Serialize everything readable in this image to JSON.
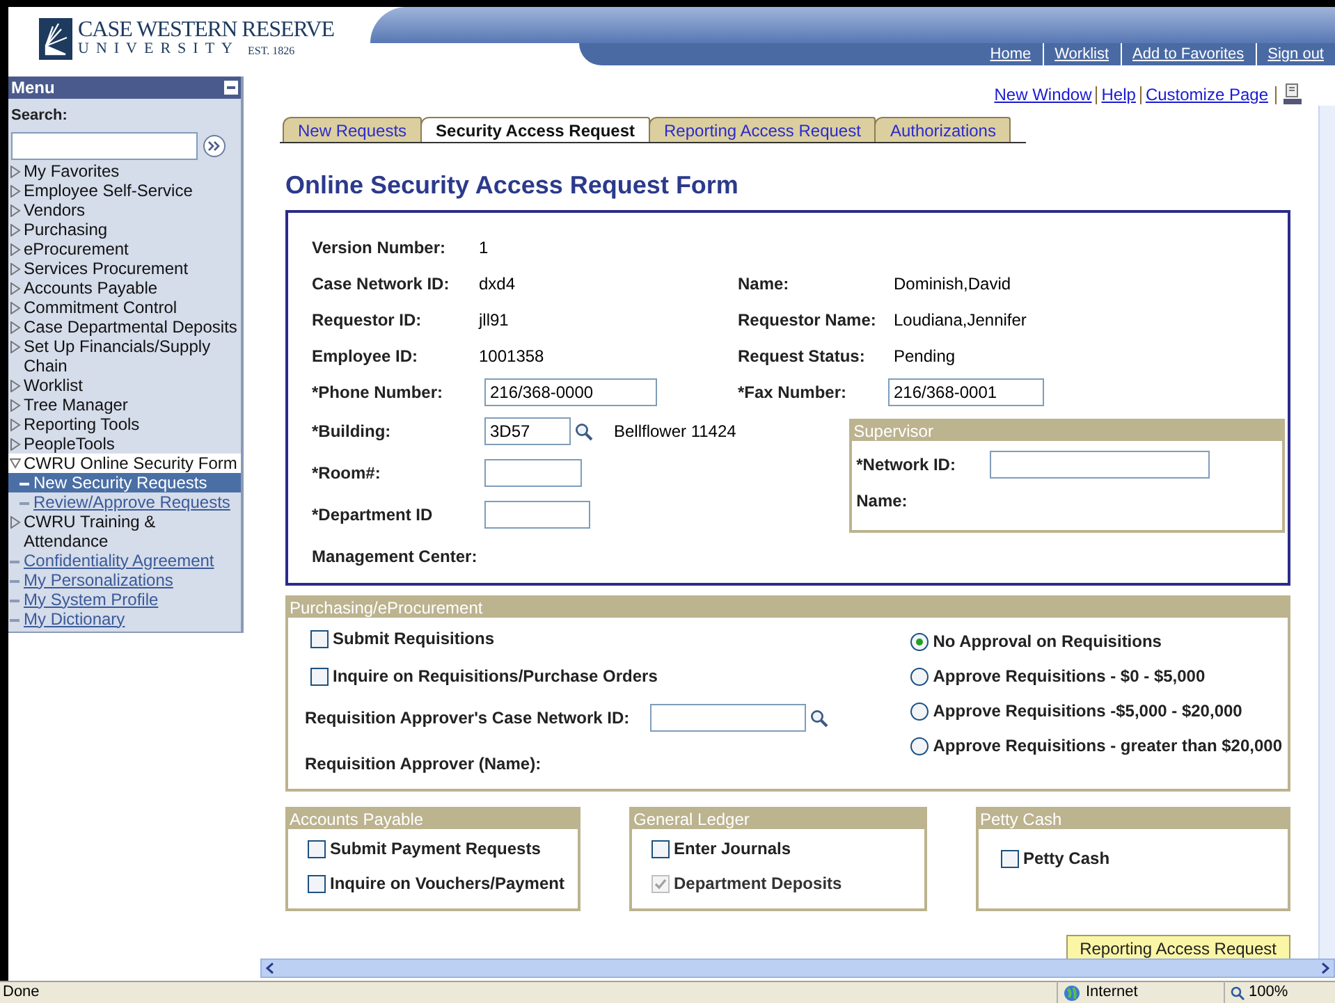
{
  "logo": {
    "name": "CASE WESTERN RESERVE",
    "sub": "UNIVERSITY",
    "est": "EST. 1826"
  },
  "header_links": [
    "Home",
    "Worklist",
    "Add to Favorites",
    "Sign out"
  ],
  "menu": {
    "title": "Menu",
    "search_label": "Search:",
    "items": [
      {
        "label": "My Favorites",
        "kind": "folder",
        "expanded": false,
        "selected": false
      },
      {
        "label": "Employee Self-Service",
        "kind": "folder",
        "expanded": false,
        "selected": false
      },
      {
        "label": "Vendors",
        "kind": "folder",
        "expanded": false,
        "selected": false
      },
      {
        "label": "Purchasing",
        "kind": "folder",
        "expanded": false,
        "selected": false
      },
      {
        "label": "eProcurement",
        "kind": "folder",
        "expanded": false,
        "selected": false
      },
      {
        "label": "Services Procurement",
        "kind": "folder",
        "expanded": false,
        "selected": false
      },
      {
        "label": "Accounts Payable",
        "kind": "folder",
        "expanded": false,
        "selected": false
      },
      {
        "label": "Commitment Control",
        "kind": "folder",
        "expanded": false,
        "selected": false
      },
      {
        "label": "Case Departmental Deposits",
        "kind": "folder",
        "expanded": false,
        "selected": false
      },
      {
        "label": "Set Up Financials/Supply Chain",
        "kind": "folder",
        "expanded": false,
        "selected": false
      },
      {
        "label": "Worklist",
        "kind": "folder",
        "expanded": false,
        "selected": false
      },
      {
        "label": "Tree Manager",
        "kind": "folder",
        "expanded": false,
        "selected": false
      },
      {
        "label": "Reporting Tools",
        "kind": "folder",
        "expanded": false,
        "selected": false
      },
      {
        "label": "PeopleTools",
        "kind": "folder",
        "expanded": false,
        "selected": false
      },
      {
        "label": "CWRU Online Security Form",
        "kind": "folder",
        "expanded": true,
        "selected": false,
        "children": [
          {
            "label": "New Security Requests",
            "kind": "link",
            "selected": true
          },
          {
            "label": "Review/Approve Requests",
            "kind": "link",
            "selected": false
          }
        ]
      },
      {
        "label": "CWRU Training & Attendance",
        "kind": "folder",
        "expanded": false,
        "selected": false
      },
      {
        "label": "Confidentiality Agreement",
        "kind": "link",
        "selected": false
      },
      {
        "label": "My Personalizations",
        "kind": "link",
        "selected": false
      },
      {
        "label": "My System Profile",
        "kind": "link",
        "selected": false
      },
      {
        "label": "My Dictionary",
        "kind": "link",
        "selected": false
      }
    ]
  },
  "page_links": [
    "New Window",
    "Help",
    "Customize Page"
  ],
  "tabs": [
    {
      "label": "New Requests",
      "selected": false
    },
    {
      "label": "Security Access Request",
      "selected": true
    },
    {
      "label": "Reporting Access Request",
      "selected": false
    },
    {
      "label": "Authorizations",
      "selected": false
    }
  ],
  "form": {
    "title": "Online Security Access Request Form",
    "info_rows": [
      [
        {
          "label": "Version Number:",
          "kind": "text",
          "value": "1"
        }
      ],
      [
        {
          "label": "Case Network ID:",
          "kind": "text",
          "value": "dxd4"
        },
        {
          "label": "Name:",
          "kind": "text",
          "value": "Dominish,David"
        }
      ],
      [
        {
          "label": "Requestor ID:",
          "kind": "text",
          "value": "jll91"
        },
        {
          "label": "Requestor Name:",
          "kind": "text",
          "value": "Loudiana,Jennifer"
        }
      ],
      [
        {
          "label": "Employee ID:",
          "kind": "text",
          "value": "1001358"
        },
        {
          "label": "Request Status:",
          "kind": "text",
          "value": "Pending"
        }
      ],
      [
        {
          "label": "*Phone Number:",
          "kind": "input",
          "value": "216/368-0000"
        },
        {
          "label": "*Fax Number:",
          "kind": "input",
          "value": "216/368-0001"
        }
      ]
    ],
    "lower_fields": [
      {
        "label": "*Building:",
        "kind": "input",
        "value": "3D57",
        "lookup": true,
        "description": "Bellflower 11424"
      },
      {
        "label": "*Room#:",
        "kind": "input"
      },
      {
        "label": "*Department ID",
        "kind": "input"
      },
      {
        "label": "Management Center:"
      }
    ],
    "supervisor": {
      "title": "Supervisor",
      "fields": [
        {
          "label": "*Network ID:",
          "kind": "input"
        },
        {
          "label": "Name:"
        }
      ]
    }
  },
  "purchasing": {
    "title": "Purchasing/eProcurement",
    "checkboxes": [
      {
        "label": "Submit Requisitions",
        "checked": false,
        "disabled": false
      },
      {
        "label": "Inquire on Requisitions/Purchase Orders",
        "checked": false,
        "disabled": false
      }
    ],
    "approver_field": {
      "label": "Requisition Approver's Case Network ID:",
      "kind": "input",
      "lookup": true
    },
    "approver_name": {
      "label": "Requisition Approver (Name):"
    },
    "radios": [
      {
        "label": "No Approval on Requisitions",
        "selected": true
      },
      {
        "label": "Approve Requisitions - $0 - $5,000",
        "selected": false
      },
      {
        "label": "Approve Requisitions -$5,000 - $20,000",
        "selected": false
      },
      {
        "label": "Approve Requisitions - greater than $20,000",
        "selected": false
      }
    ]
  },
  "groups": [
    {
      "title": "Accounts Payable",
      "checkboxes": [
        {
          "label": "Submit Payment Requests",
          "checked": false,
          "disabled": false
        },
        {
          "label": "Inquire on Vouchers/Payment",
          "checked": false,
          "disabled": false
        }
      ]
    },
    {
      "title": "General Ledger",
      "checkboxes": [
        {
          "label": "Enter Journals",
          "checked": false,
          "disabled": false
        },
        {
          "label": "Department Deposits",
          "checked": true,
          "disabled": true
        }
      ]
    },
    {
      "title": "Petty Cash",
      "checkboxes": [
        {
          "label": "Petty Cash",
          "checked": false,
          "disabled": false
        }
      ]
    }
  ],
  "action_button": "Reporting Access Request",
  "status_bar": {
    "status": "Done",
    "zone": "Internet",
    "zoom": "100%"
  }
}
